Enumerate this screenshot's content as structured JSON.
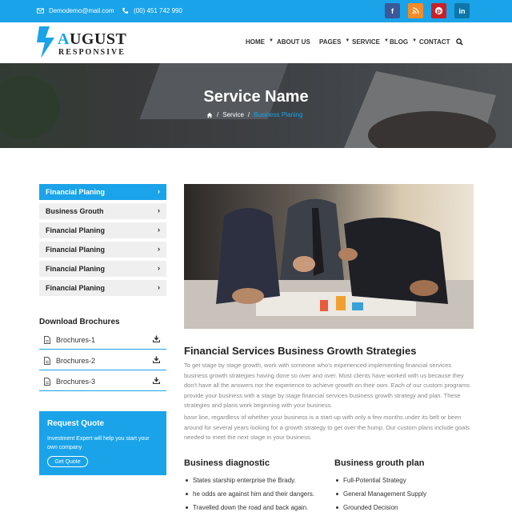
{
  "topbar": {
    "email": "Demodemo@mail.com",
    "phone": "(00) 451 742 990",
    "socials": [
      {
        "name": "facebook-icon",
        "glyph": "f",
        "color": "#3b5998"
      },
      {
        "name": "rss-icon",
        "glyph": "",
        "color": "#f48b26"
      },
      {
        "name": "pinterest-icon",
        "glyph": "P",
        "color": "#cb2027"
      },
      {
        "name": "linkedin-icon",
        "glyph": "in",
        "color": "#0e76a8"
      }
    ],
    "bg": "#1aa3e8"
  },
  "logo": {
    "main_first": "A",
    "main_rest": "UGUST",
    "sub": "RESPONSIVE"
  },
  "nav": {
    "home": "HOME",
    "about": "ABOUT US",
    "pages": "PAGES",
    "service": "SERVICE",
    "blog": "BLOG",
    "contact": "CONTACT"
  },
  "hero": {
    "title": "Service Name",
    "crumb_home": "home-icon",
    "crumb_1": "Service",
    "crumb_2": "Business Planing"
  },
  "sidebar": {
    "items": [
      {
        "label": "Financial Planing",
        "active": true
      },
      {
        "label": "Business Grouth",
        "active": false
      },
      {
        "label": "Financial Planing",
        "active": false
      },
      {
        "label": "Financial Planing",
        "active": false
      },
      {
        "label": "Financial Planing",
        "active": false
      },
      {
        "label": "Financial Planing",
        "active": false
      }
    ],
    "download_title": "Download Brochures",
    "brochures": [
      "Brochures-1",
      "Brochures-2",
      "Brochures-3"
    ],
    "quote": {
      "title": "Request Quote",
      "desc": "Investment Expert will help you start your own company",
      "button": "Get Quote"
    }
  },
  "main": {
    "title": "Financial Services Business Growth Strategies",
    "para1": "To get stage by stage growth, work with someone who's experienced implementing financial services business growth strategies having done so over and over. Most clients have worked with us because they don't have all the answers nor the experience to achieve growth on their own. Each of our custom programs provide your business with a stage by stage financial services business growth strategy and plan. These strategies and plans work beginning with your business.",
    "para2": "base line, regardless of whether your business is a start-up with only a few months under its belt or been around for several years looking for a growth strategy to get over the hump. Our custom plans include goals needed to meet the next stage in your business.",
    "diag_title": "Business diagnostic",
    "diag_items": [
      "States starship enterprise the Brady.",
      "he odds are against him and their dangers.",
      "Travelled down the road and back again."
    ],
    "growth_title": "Business grouth plan",
    "growth_items": [
      "Full-Potential Strategy",
      "General Management Supply",
      "Grounded Decision"
    ]
  },
  "accent": "#1aa3e8"
}
